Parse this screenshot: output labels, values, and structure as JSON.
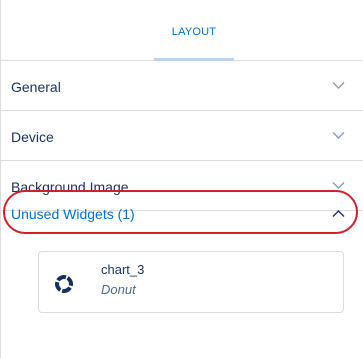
{
  "tabs": [
    {
      "label": "LAYOUT",
      "active": true
    }
  ],
  "sections": [
    {
      "label": "General",
      "expanded": false,
      "icon": "chevron-down-icon"
    },
    {
      "label": "Device",
      "expanded": false,
      "icon": "chevron-down-icon"
    },
    {
      "label": "Background Image",
      "expanded": false,
      "icon": "chevron-down-icon"
    },
    {
      "label": "Unused Widgets (1)",
      "expanded": true,
      "icon": "chevron-up-icon"
    }
  ],
  "unused_widgets": [
    {
      "name": "chart_3",
      "type": "Donut",
      "icon": "donut-chart-icon"
    }
  ],
  "colors": {
    "accent": "#0070d2",
    "text": "#16325c",
    "muted": "#54698d",
    "border": "#dddbda",
    "highlight": "#d21f2a"
  }
}
